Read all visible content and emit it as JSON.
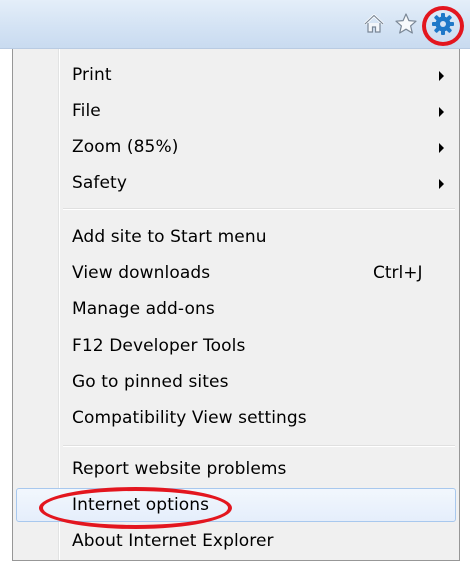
{
  "toolbar": {
    "icons": [
      "home-icon",
      "favorites-star-icon",
      "tools-gear-icon"
    ],
    "colors": {
      "gear": "#1e78c8",
      "annotation": "#e3161f",
      "toolbar_bg": "#d4e3f4"
    }
  },
  "menu": {
    "groups": [
      {
        "items": [
          {
            "label": "Print",
            "submenu": true
          },
          {
            "label": "File",
            "submenu": true
          },
          {
            "label": "Zoom (85%)",
            "submenu": true
          },
          {
            "label": "Safety",
            "submenu": true
          }
        ]
      },
      {
        "items": [
          {
            "label": "Add site to Start menu"
          },
          {
            "label": "View downloads",
            "shortcut": "Ctrl+J"
          },
          {
            "label": "Manage add-ons"
          },
          {
            "label": "F12 Developer Tools"
          },
          {
            "label": "Go to pinned sites"
          },
          {
            "label": "Compatibility View settings"
          }
        ]
      },
      {
        "items": [
          {
            "label": "Report website problems"
          },
          {
            "label": "Internet options",
            "highlighted": true
          },
          {
            "label": "About Internet Explorer"
          }
        ]
      }
    ]
  }
}
